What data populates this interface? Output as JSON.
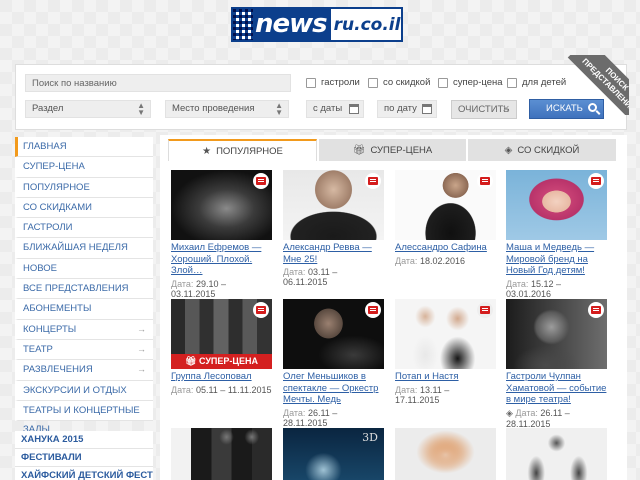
{
  "logo": {
    "main": "news",
    "tld": "ru.co.il"
  },
  "search": {
    "placeholder": "Поиск по названию",
    "checkboxes": [
      "гастроли",
      "со скидкой",
      "супер-цена",
      "для детей"
    ],
    "section_select": "Раздел",
    "venue_select": "Место проведения",
    "date_from": "с даты",
    "date_to": "по дату",
    "clear_label": "ОЧИСТИТЬ",
    "search_label": "ИСКАТЬ",
    "ribbon": "ПОИСК ПРЕДСТАВЛЕНИЯ:"
  },
  "sidebar": {
    "items": [
      {
        "label": "ГЛАВНАЯ"
      },
      {
        "label": "СУПЕР-ЦЕНА"
      },
      {
        "label": "ПОПУЛЯРНОЕ"
      },
      {
        "label": "СО СКИДКАМИ"
      },
      {
        "label": "ГАСТРОЛИ"
      },
      {
        "label": "БЛИЖАЙШАЯ НЕДЕЛЯ"
      },
      {
        "label": "НОВОЕ"
      },
      {
        "label": "ВСЕ ПРЕДСТАВЛЕНИЯ"
      },
      {
        "label": "АБОНЕМЕНТЫ"
      },
      {
        "label": "КОНЦЕРТЫ"
      },
      {
        "label": "ТЕАТР"
      },
      {
        "label": "РАЗВЛЕЧЕНИЯ"
      },
      {
        "label": "ЭКСКУРСИИ И ОТДЫХ"
      },
      {
        "label": "ТЕАТРЫ И КОНЦЕРТНЫЕ ЗАЛЫ"
      }
    ],
    "arrow": "→",
    "sections": [
      "ХАНУКА 2015",
      "ФЕСТИВАЛИ",
      "ХАЙФСКИЙ ДЕТСКИЙ ФЕСТИВАЛЬ"
    ]
  },
  "tabs": [
    {
      "label": "ПОПУЛЯРНОЕ",
      "icon": "star-icon"
    },
    {
      "label": "СУПЕР-ЦЕНА",
      "icon": "gift-icon"
    },
    {
      "label": "СО СКИДКОЙ",
      "icon": "tag-icon"
    }
  ],
  "date_label": "Дата:",
  "super_price_banner": "СУПЕР-ЦЕНА",
  "label_3d": "3D",
  "events": [
    {
      "title": "Михаил Ефремов — Хороший. Плохой. Злой…",
      "date": "29.10 – 03.11.2015"
    },
    {
      "title": "Александр Ревва — Мне 25!",
      "date": "03.11 – 06.11.2015"
    },
    {
      "title": "Алессандро Сафина",
      "date": "18.02.2016"
    },
    {
      "title": "Маша и Медведь — Мировой бренд на Новый Год детям!",
      "date": "15.12 – 03.01.2016"
    },
    {
      "title": "Группа Лесоповал",
      "date": "05.11 – 11.11.2015"
    },
    {
      "title": "Олег Меньшиков в спектакле — Оркестр Мечты. Медь",
      "date": "26.11 – 28.11.2015"
    },
    {
      "title": "Потап и Настя",
      "date": "13.11 – 17.11.2015"
    },
    {
      "title": "Гастроли Чулпан Хаматовой — событие в мире театра!",
      "date": "26.11 – 28.11.2015"
    }
  ],
  "colors": {
    "accent": "#f29a1c",
    "link": "#2d5fa5",
    "button": "#3f72bd",
    "badge": "#d41d1d"
  }
}
